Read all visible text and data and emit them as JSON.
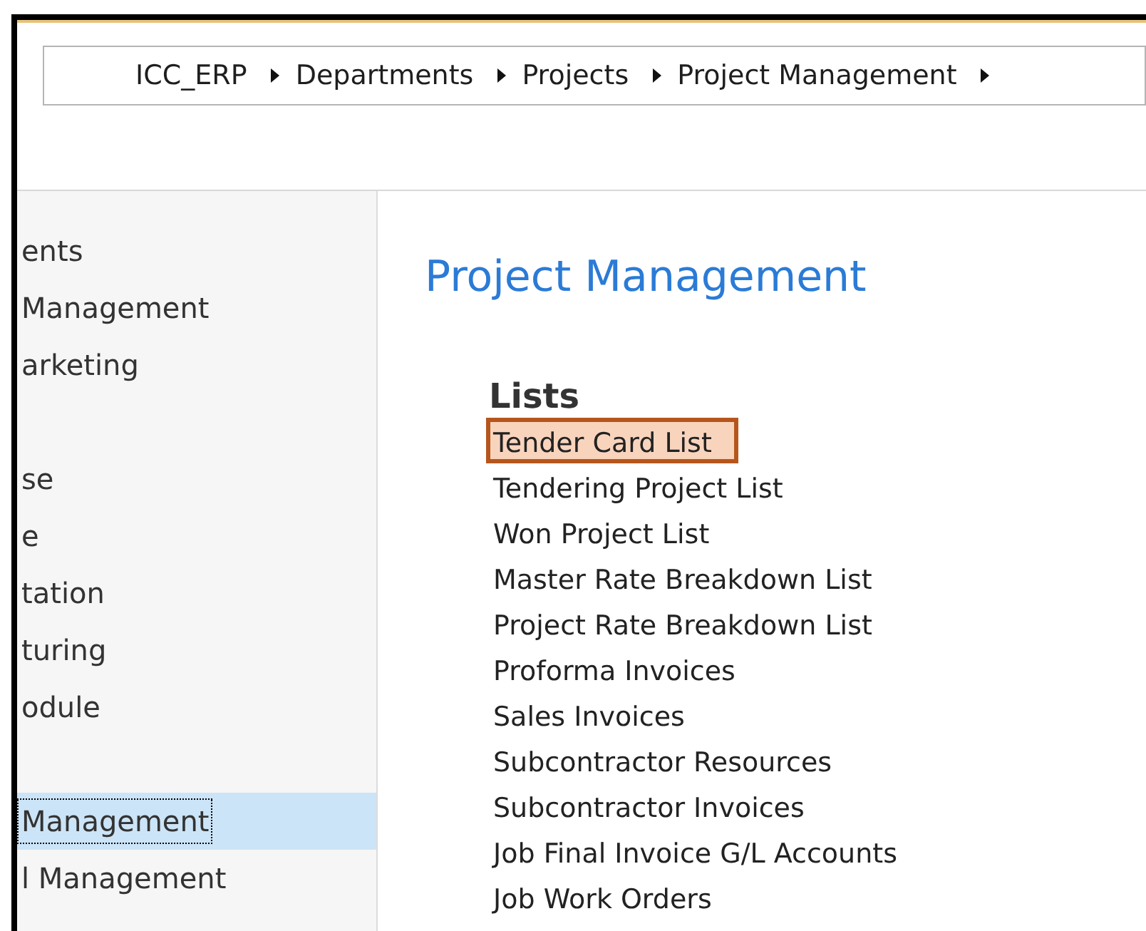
{
  "breadcrumb": [
    "ICC_ERP",
    "Departments",
    "Projects",
    "Project Management"
  ],
  "sidebar": {
    "groups": [
      [
        {
          "label": "ents",
          "selected": false
        },
        {
          "label": "Management",
          "selected": false
        },
        {
          "label": "arketing",
          "selected": false
        }
      ],
      [
        {
          "label": "se",
          "selected": false
        },
        {
          "label": "e",
          "selected": false
        },
        {
          "label": "tation",
          "selected": false
        },
        {
          "label": "turing",
          "selected": false
        },
        {
          "label": "odule",
          "selected": false
        }
      ],
      [
        {
          "label": "Management",
          "selected": true
        },
        {
          "label": "l Management",
          "selected": false
        }
      ]
    ]
  },
  "page": {
    "title": "Project Management",
    "section": "Lists",
    "items": [
      {
        "label": "Tender Card List",
        "highlighted": true
      },
      {
        "label": "Tendering Project List",
        "highlighted": false
      },
      {
        "label": "Won Project List",
        "highlighted": false
      },
      {
        "label": "Master Rate Breakdown List",
        "highlighted": false
      },
      {
        "label": "Project Rate Breakdown List",
        "highlighted": false
      },
      {
        "label": "Proforma Invoices",
        "highlighted": false
      },
      {
        "label": "Sales Invoices",
        "highlighted": false
      },
      {
        "label": "Subcontractor Resources",
        "highlighted": false
      },
      {
        "label": "Subcontractor Invoices",
        "highlighted": false
      },
      {
        "label": "Job Final Invoice G/L Accounts",
        "highlighted": false
      },
      {
        "label": "Job Work Orders",
        "highlighted": false
      }
    ]
  }
}
